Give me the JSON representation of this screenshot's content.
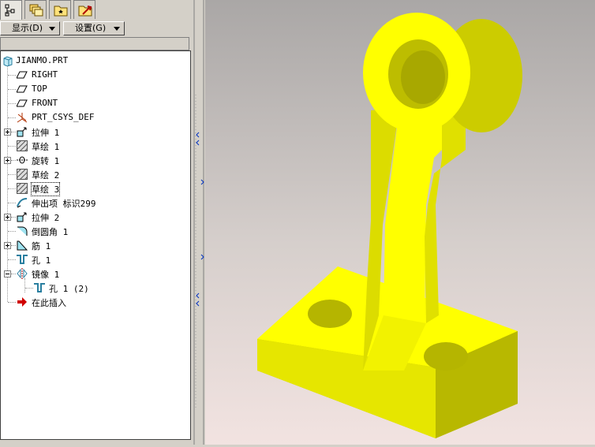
{
  "tabs": [
    {
      "name": "model-tree",
      "icon": "model-tree-icon"
    },
    {
      "name": "layers",
      "icon": "layers-icon"
    },
    {
      "name": "favorites",
      "icon": "folder-star-icon"
    },
    {
      "name": "connections",
      "icon": "connections-icon"
    }
  ],
  "menu": {
    "show_label": "显示(D)",
    "settings_label": "设置(G)"
  },
  "tree": {
    "root": "JIANMO.PRT",
    "items": [
      {
        "label": "RIGHT",
        "icon": "datum-plane-icon"
      },
      {
        "label": "TOP",
        "icon": "datum-plane-icon"
      },
      {
        "label": "FRONT",
        "icon": "datum-plane-icon"
      },
      {
        "label": "PRT_CSYS_DEF",
        "icon": "csys-icon"
      },
      {
        "label": "拉伸 1",
        "icon": "extrude-icon"
      },
      {
        "label": "草绘 1",
        "icon": "sketch-icon"
      },
      {
        "label": "旋转 1",
        "icon": "revolve-icon"
      },
      {
        "label": "草绘 2",
        "icon": "sketch-icon"
      },
      {
        "label": "草绘 3",
        "icon": "sketch-icon"
      },
      {
        "label": "伸出项 标识299",
        "icon": "sweep-icon"
      },
      {
        "label": "拉伸 2",
        "icon": "extrude-icon"
      },
      {
        "label": "倒圆角 1",
        "icon": "round-icon"
      },
      {
        "label": "筋 1",
        "icon": "rib-icon"
      },
      {
        "label": "孔 1",
        "icon": "hole-icon"
      },
      {
        "label": "镜像 1",
        "icon": "mirror-icon"
      },
      {
        "label": "孔 1 (2)",
        "icon": "hole-icon"
      },
      {
        "label": "在此插入",
        "icon": "insert-arrow-icon"
      }
    ]
  },
  "colors": {
    "model": "#ffff00",
    "model_shade": "#c8c800",
    "selection": "#000000"
  }
}
